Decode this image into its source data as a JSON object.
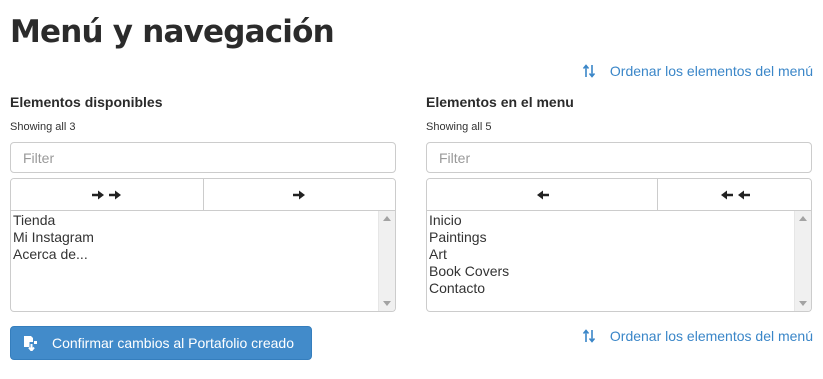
{
  "header": {
    "title": "Menú y navegación"
  },
  "order_link": {
    "label": "Ordenar los elementos del menú",
    "icon": "sort-icon"
  },
  "available": {
    "title": "Elementos disponibles",
    "showing": "Showing all 3",
    "filter_placeholder": "Filter",
    "move_all_icon": "double-arrow-right-icon",
    "move_selected_icon": "arrow-right-icon",
    "items": [
      "Tienda",
      "Mi Instagram",
      "Acerca de..."
    ]
  },
  "menu": {
    "title": "Elementos en el menu",
    "showing": "Showing all 5",
    "filter_placeholder": "Filter",
    "remove_selected_icon": "arrow-left-icon",
    "remove_all_icon": "double-arrow-left-icon",
    "items": [
      "Inicio",
      "Paintings",
      "Art",
      "Book Covers",
      "Contacto"
    ]
  },
  "confirm_button": {
    "label": "Confirmar cambios al Portafolio creado",
    "icon": "cms-icon"
  },
  "colors": {
    "accent": "#428bca",
    "link": "#3a86c8",
    "border": "#cccccc"
  }
}
